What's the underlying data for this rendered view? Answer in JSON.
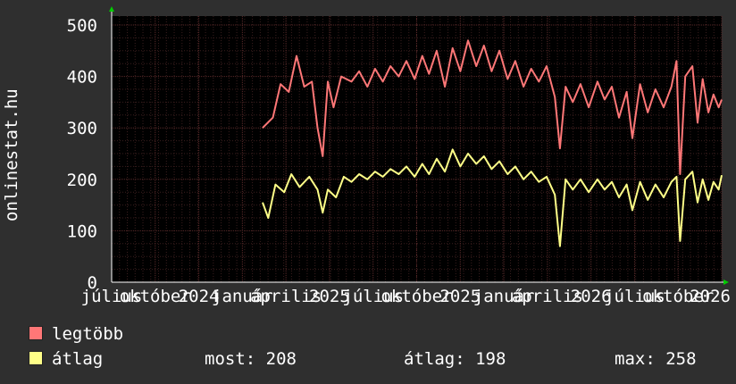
{
  "chart_data": {
    "type": "line",
    "title": "",
    "ylabel": "onlinestat.hu",
    "ylim": [
      0,
      500
    ],
    "yticks": [
      "0",
      "100",
      "200",
      "300",
      "400",
      "500"
    ],
    "x_tick_labels": [
      "július",
      "október",
      "2024",
      "január",
      "április",
      "2025",
      "július",
      "október",
      "2025",
      "január",
      "április",
      "2026",
      "július",
      "október",
      "2026"
    ],
    "grid": true,
    "x_start": "2023-07-01",
    "x_end": "2026-10-01",
    "series": [
      {
        "name": "legtöbb",
        "color": "#ff7777",
        "points": [
          [
            "2024-04-20",
            300
          ],
          [
            "2024-05-10",
            320
          ],
          [
            "2024-05-25",
            385
          ],
          [
            "2024-06-10",
            370
          ],
          [
            "2024-06-25",
            440
          ],
          [
            "2024-07-10",
            380
          ],
          [
            "2024-07-25",
            390
          ],
          [
            "2024-08-05",
            300
          ],
          [
            "2024-08-15",
            245
          ],
          [
            "2024-08-25",
            390
          ],
          [
            "2024-09-05",
            340
          ],
          [
            "2024-09-20",
            400
          ],
          [
            "2024-10-10",
            390
          ],
          [
            "2024-10-25",
            410
          ],
          [
            "2024-11-10",
            380
          ],
          [
            "2024-11-25",
            415
          ],
          [
            "2024-12-10",
            390
          ],
          [
            "2024-12-25",
            420
          ],
          [
            "2025-01-10",
            400
          ],
          [
            "2025-01-25",
            430
          ],
          [
            "2025-02-10",
            395
          ],
          [
            "2025-02-25",
            440
          ],
          [
            "2025-03-10",
            405
          ],
          [
            "2025-03-25",
            450
          ],
          [
            "2025-04-10",
            380
          ],
          [
            "2025-04-25",
            455
          ],
          [
            "2025-05-10",
            410
          ],
          [
            "2025-05-25",
            470
          ],
          [
            "2025-06-10",
            420
          ],
          [
            "2025-06-25",
            460
          ],
          [
            "2025-07-10",
            410
          ],
          [
            "2025-07-25",
            450
          ],
          [
            "2025-08-10",
            395
          ],
          [
            "2025-08-25",
            430
          ],
          [
            "2025-09-10",
            380
          ],
          [
            "2025-09-25",
            415
          ],
          [
            "2025-10-10",
            390
          ],
          [
            "2025-10-25",
            420
          ],
          [
            "2025-11-10",
            360
          ],
          [
            "2025-11-20",
            260
          ],
          [
            "2025-12-01",
            380
          ],
          [
            "2025-12-15",
            350
          ],
          [
            "2025-12-30",
            385
          ],
          [
            "2026-01-15",
            340
          ],
          [
            "2026-02-01",
            390
          ],
          [
            "2026-02-15",
            355
          ],
          [
            "2026-03-01",
            380
          ],
          [
            "2026-03-15",
            320
          ],
          [
            "2026-03-30",
            370
          ],
          [
            "2026-04-10",
            280
          ],
          [
            "2026-04-25",
            385
          ],
          [
            "2026-05-10",
            330
          ],
          [
            "2026-05-25",
            375
          ],
          [
            "2026-06-10",
            340
          ],
          [
            "2026-06-25",
            380
          ],
          [
            "2026-07-05",
            430
          ],
          [
            "2026-07-12",
            210
          ],
          [
            "2026-07-22",
            400
          ],
          [
            "2026-08-05",
            420
          ],
          [
            "2026-08-15",
            310
          ],
          [
            "2026-08-25",
            395
          ],
          [
            "2026-09-05",
            330
          ],
          [
            "2026-09-15",
            365
          ],
          [
            "2026-09-25",
            340
          ],
          [
            "2026-10-01",
            355
          ]
        ]
      },
      {
        "name": "átlag",
        "color": "#ffff88",
        "points": [
          [
            "2024-04-20",
            155
          ],
          [
            "2024-05-01",
            125
          ],
          [
            "2024-05-15",
            190
          ],
          [
            "2024-06-01",
            175
          ],
          [
            "2024-06-15",
            210
          ],
          [
            "2024-07-01",
            185
          ],
          [
            "2024-07-20",
            205
          ],
          [
            "2024-08-05",
            180
          ],
          [
            "2024-08-15",
            135
          ],
          [
            "2024-08-25",
            180
          ],
          [
            "2024-09-10",
            165
          ],
          [
            "2024-09-25",
            205
          ],
          [
            "2024-10-10",
            195
          ],
          [
            "2024-10-25",
            210
          ],
          [
            "2024-11-10",
            200
          ],
          [
            "2024-11-25",
            215
          ],
          [
            "2024-12-10",
            205
          ],
          [
            "2024-12-25",
            220
          ],
          [
            "2025-01-10",
            210
          ],
          [
            "2025-01-25",
            225
          ],
          [
            "2025-02-10",
            205
          ],
          [
            "2025-02-25",
            230
          ],
          [
            "2025-03-10",
            210
          ],
          [
            "2025-03-25",
            240
          ],
          [
            "2025-04-10",
            215
          ],
          [
            "2025-04-25",
            258
          ],
          [
            "2025-05-10",
            225
          ],
          [
            "2025-05-25",
            250
          ],
          [
            "2025-06-10",
            230
          ],
          [
            "2025-06-25",
            245
          ],
          [
            "2025-07-10",
            220
          ],
          [
            "2025-07-25",
            235
          ],
          [
            "2025-08-10",
            210
          ],
          [
            "2025-08-25",
            225
          ],
          [
            "2025-09-10",
            200
          ],
          [
            "2025-09-25",
            215
          ],
          [
            "2025-10-10",
            195
          ],
          [
            "2025-10-25",
            205
          ],
          [
            "2025-11-10",
            170
          ],
          [
            "2025-11-20",
            70
          ],
          [
            "2025-12-01",
            200
          ],
          [
            "2025-12-15",
            180
          ],
          [
            "2025-12-30",
            200
          ],
          [
            "2026-01-15",
            175
          ],
          [
            "2026-02-01",
            200
          ],
          [
            "2026-02-15",
            180
          ],
          [
            "2026-03-01",
            195
          ],
          [
            "2026-03-15",
            165
          ],
          [
            "2026-03-30",
            190
          ],
          [
            "2026-04-10",
            140
          ],
          [
            "2026-04-25",
            195
          ],
          [
            "2026-05-10",
            160
          ],
          [
            "2026-05-25",
            190
          ],
          [
            "2026-06-10",
            165
          ],
          [
            "2026-06-25",
            195
          ],
          [
            "2026-07-05",
            205
          ],
          [
            "2026-07-12",
            80
          ],
          [
            "2026-07-22",
            200
          ],
          [
            "2026-08-05",
            215
          ],
          [
            "2026-08-15",
            155
          ],
          [
            "2026-08-25",
            200
          ],
          [
            "2026-09-05",
            160
          ],
          [
            "2026-09-15",
            195
          ],
          [
            "2026-09-25",
            180
          ],
          [
            "2026-10-01",
            208
          ]
        ]
      }
    ]
  },
  "legend": {
    "max_label": "legtöbb",
    "avg_label": "átlag",
    "now_text": "most: 208",
    "avg_text": "átlag: 198",
    "max_text": "max: 258"
  },
  "colors": {
    "background": "#2f2f2f",
    "plot_background": "#000000",
    "grid_major": "#5a2a2a",
    "grid_minor": "#3a1e1e",
    "axis": "#ffffff",
    "arrow": "#00cc00"
  }
}
